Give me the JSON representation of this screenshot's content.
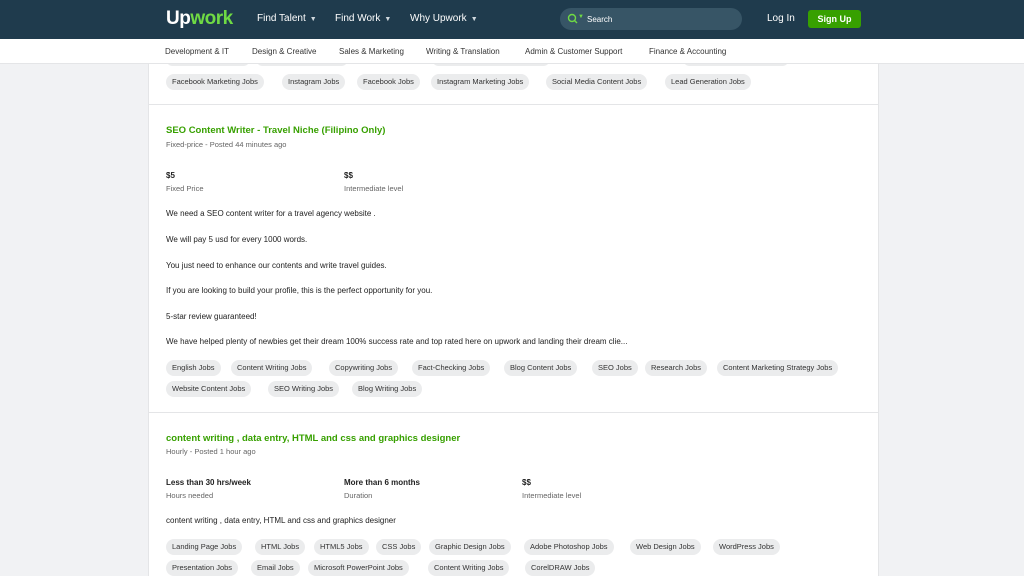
{
  "header": {
    "logo_up": "Up",
    "logo_work": "work",
    "nav": [
      "Find Talent",
      "Find Work",
      "Why Upwork"
    ],
    "search_placeholder": "Search",
    "login": "Log In",
    "signup": "Sign Up"
  },
  "categories": [
    "Development & IT",
    "Design & Creative",
    "Sales & Marketing",
    "Writing & Translation",
    "Admin & Customer Support",
    "Finance & Accounting"
  ],
  "prev_job": {
    "tags": [
      "Facebook Marketing Jobs",
      "Instagram Jobs",
      "Facebook Jobs",
      "Instagram Marketing Jobs",
      "Social Media Content Jobs",
      "Lead Generation Jobs"
    ]
  },
  "jobs": [
    {
      "title": "SEO Content Writer - Travel Niche (Filipino Only)",
      "meta": "Fixed-price - Posted 44 minutes ago",
      "stats": [
        {
          "value": "$5",
          "label": "Fixed Price"
        },
        {
          "value": "$$",
          "label": "Intermediate level"
        }
      ],
      "description": [
        "We need a SEO content writer for a travel agency website .",
        "We will pay 5 usd for every 1000 words.",
        "You just need to enhance our contents and write travel guides.",
        "If you are looking to build your profile, this is the perfect opportunity for you.",
        "5-star review guaranteed!",
        "We have helped plenty of newbies get their dream 100% success rate and top rated here on upwork and landing their dream clie..."
      ],
      "tags": [
        "English Jobs",
        "Content Writing Jobs",
        "Copywriting Jobs",
        "Fact-Checking Jobs",
        "Blog Content Jobs",
        "SEO Jobs",
        "Research Jobs",
        "Content Marketing Strategy Jobs",
        "Website Content Jobs",
        "SEO Writing Jobs",
        "Blog Writing Jobs"
      ]
    },
    {
      "title": "content writing , data entry, HTML and css and graphics designer",
      "meta": "Hourly - Posted 1 hour ago",
      "stats": [
        {
          "value": "Less than 30 hrs/week",
          "label": "Hours needed"
        },
        {
          "value": "More than 6 months",
          "label": "Duration"
        },
        {
          "value": "$$",
          "label": "Intermediate level"
        }
      ],
      "description": [
        "content writing , data entry, HTML and css and graphics designer"
      ],
      "tags": [
        "Landing Page Jobs",
        "HTML Jobs",
        "HTML5 Jobs",
        "CSS Jobs",
        "Graphic Design Jobs",
        "Adobe Photoshop Jobs",
        "Web Design Jobs",
        "WordPress Jobs",
        "Presentation Jobs",
        "Email Jobs",
        "Microsoft PowerPoint Jobs",
        "Content Writing Jobs",
        "CorelDRAW Jobs"
      ]
    }
  ],
  "colors": {
    "nav_bg": "#1f3b4d",
    "brand_green": "#6fda44",
    "title_green": "#37a000",
    "signup_bg": "#37a000"
  },
  "icons": [
    "search-icon",
    "chevron-down-icon"
  ]
}
